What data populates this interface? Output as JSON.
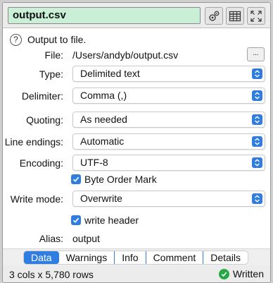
{
  "title": {
    "value": "output.csv"
  },
  "toolbar": {
    "settings_icon": "gears-icon",
    "table_icon": "table-icon",
    "expand_icon": "expand-arrows-icon"
  },
  "help": {
    "icon_glyph": "?",
    "text": "Output to file."
  },
  "file": {
    "label": "File:",
    "value": "/Users/andyb/output.csv",
    "browse_label": "..."
  },
  "type": {
    "label": "Type:",
    "value": "Delimited text"
  },
  "delimiter": {
    "label": "Delimiter:",
    "value": "Comma (,)"
  },
  "quoting": {
    "label": "Quoting:",
    "value": "As needed"
  },
  "line_endings": {
    "label": "Line endings:",
    "value": "Automatic"
  },
  "encoding": {
    "label": "Encoding:",
    "value": "UTF-8"
  },
  "byte_order_mark": {
    "label": "Byte Order Mark",
    "checked": true
  },
  "write_mode": {
    "label": "Write mode:",
    "value": "Overwrite"
  },
  "write_header": {
    "label": "write header",
    "checked": true
  },
  "alias": {
    "label": "Alias:",
    "value": "output"
  },
  "tabs": [
    {
      "label": "Data",
      "active": true
    },
    {
      "label": "Warnings",
      "active": false
    },
    {
      "label": "Info",
      "active": false
    },
    {
      "label": "Comment",
      "active": false
    },
    {
      "label": "Details",
      "active": false
    }
  ],
  "status": {
    "summary": "3 cols x 5,780 rows",
    "state": "Written"
  },
  "colors": {
    "accent": "#2f7de1",
    "title_bg": "#c9f0d6",
    "success": "#28a745"
  }
}
